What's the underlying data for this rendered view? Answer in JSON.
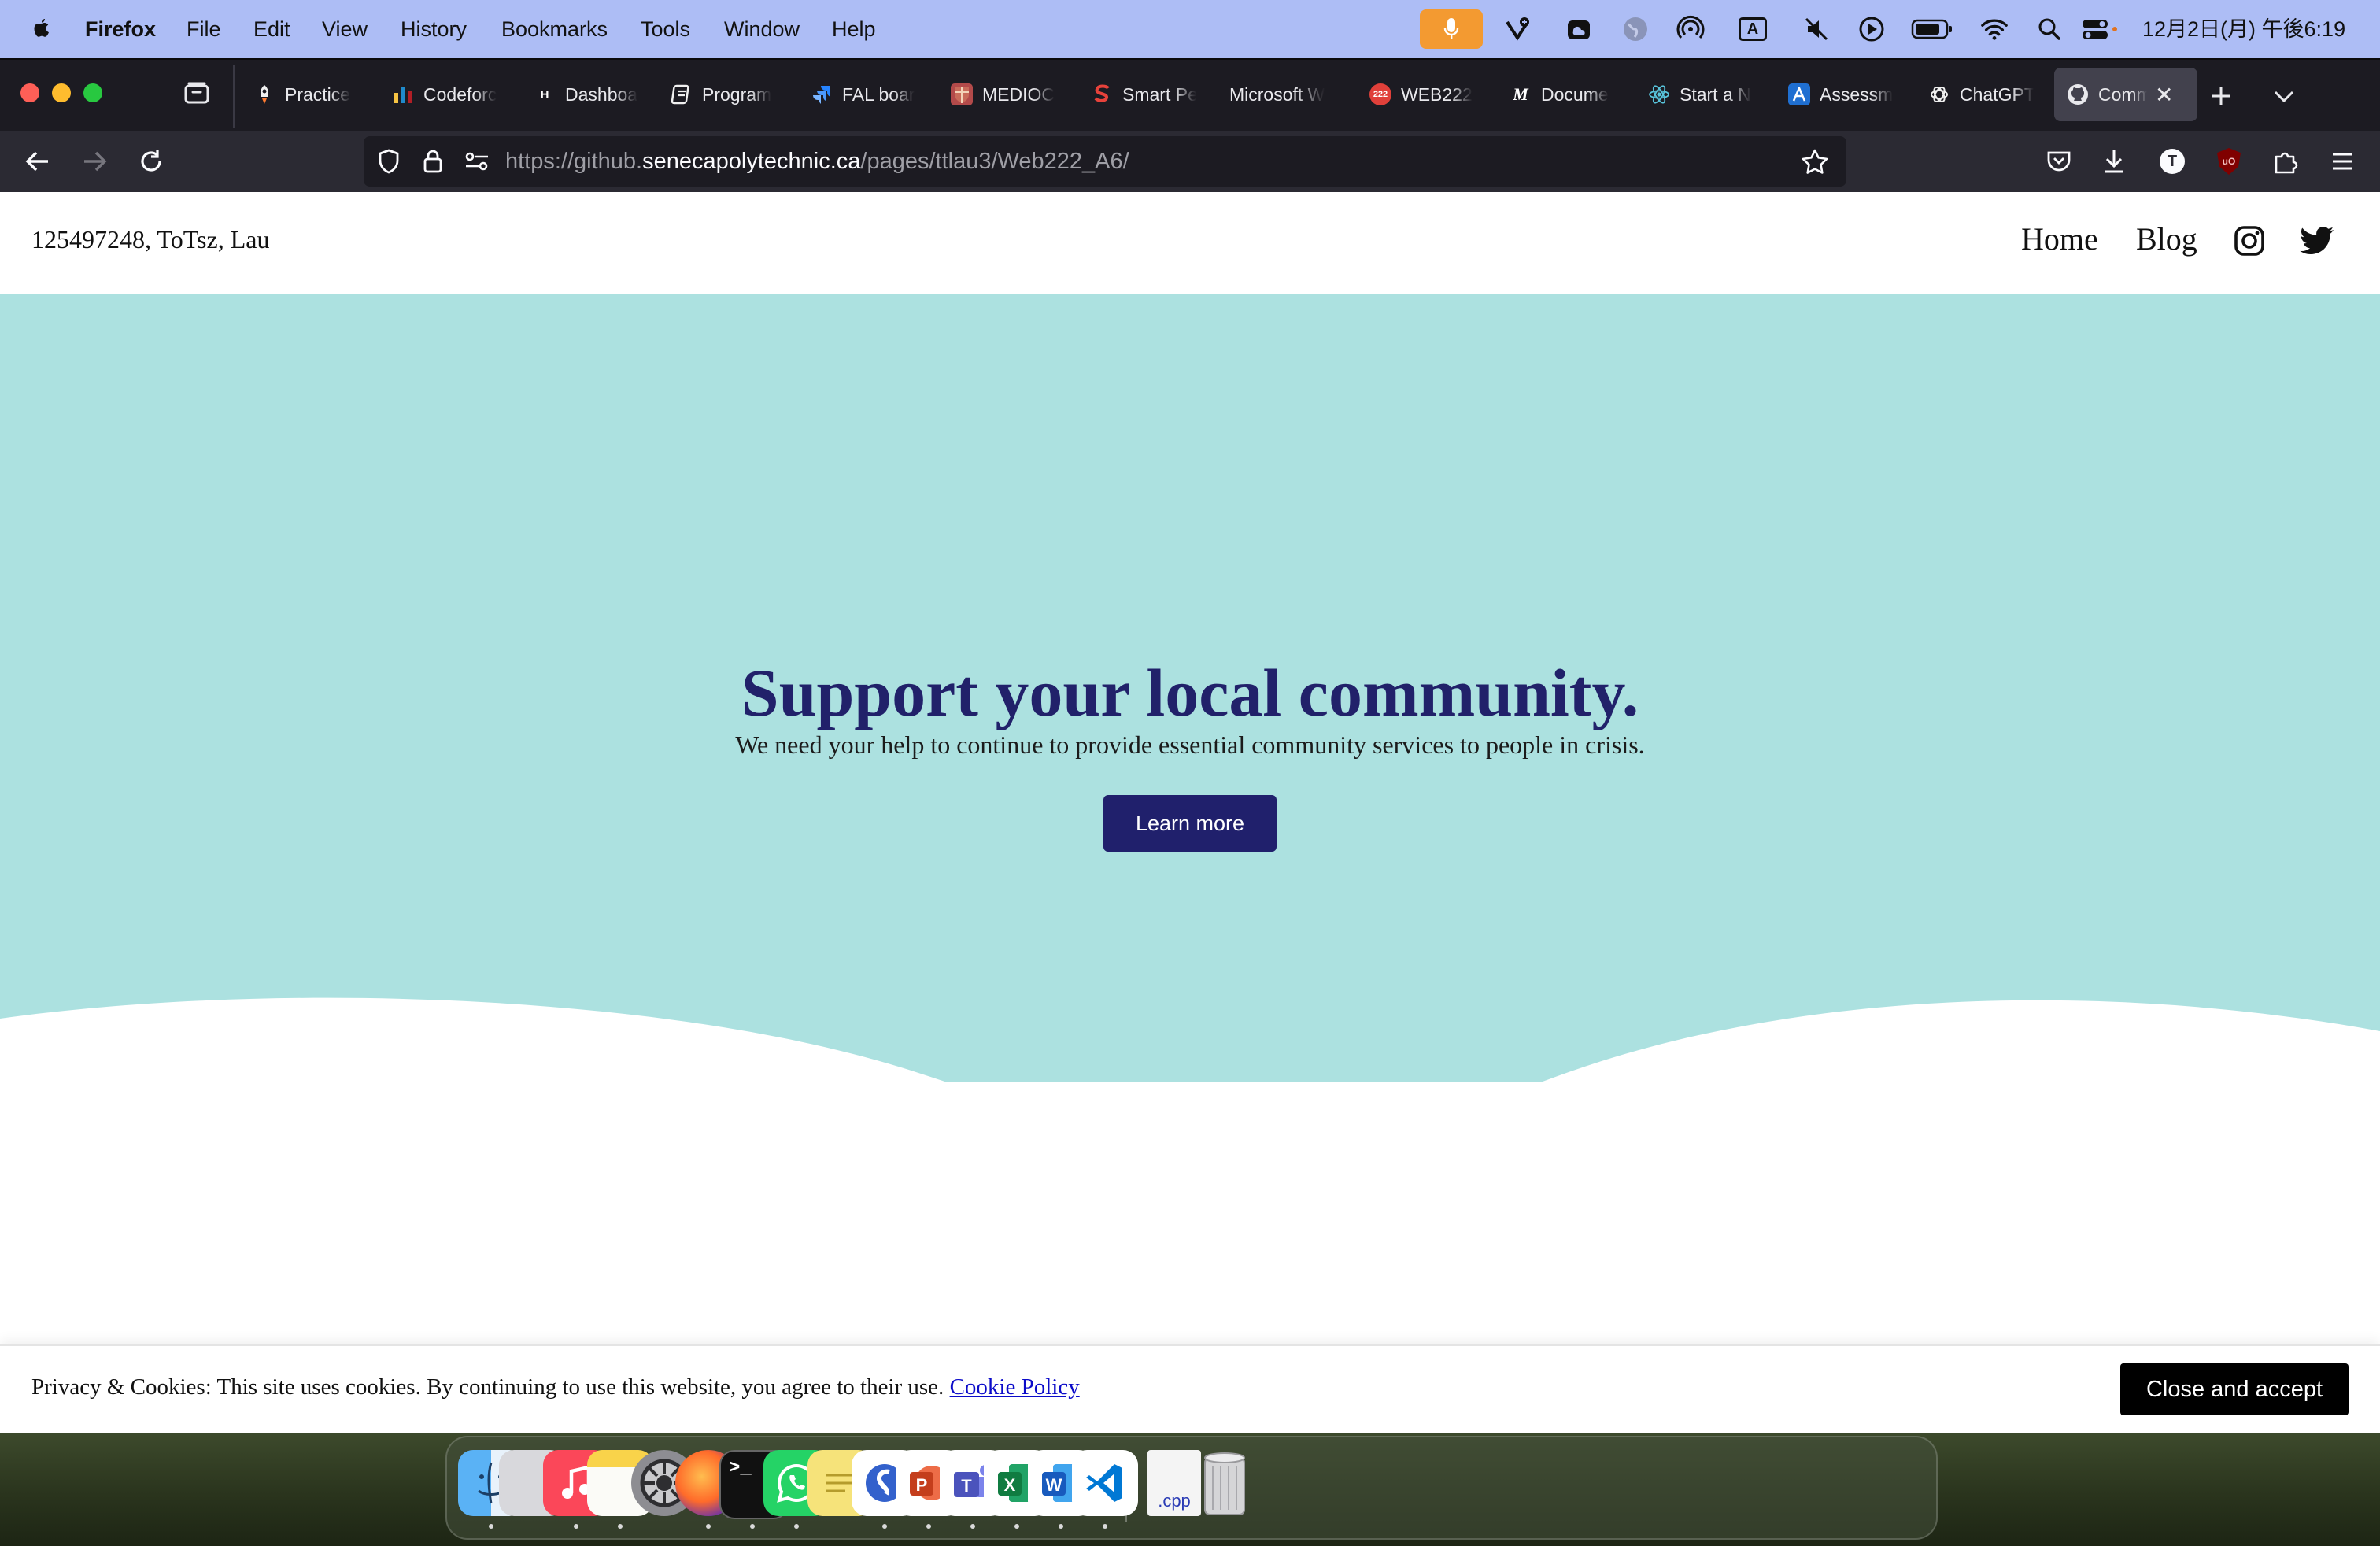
{
  "menubar": {
    "app_name": "Firefox",
    "menus": [
      "File",
      "Edit",
      "View",
      "History",
      "Bookmarks",
      "Tools",
      "Window",
      "Help"
    ],
    "clock": "12月2日(月) 午後6:19",
    "input_indicator": "A"
  },
  "browser": {
    "tabs": [
      {
        "label": "Practice"
      },
      {
        "label": "Codeforc"
      },
      {
        "label": "Dashboa"
      },
      {
        "label": "Program"
      },
      {
        "label": "FAL boar"
      },
      {
        "label": "MEDIOC"
      },
      {
        "label": "Smart Pe"
      },
      {
        "label": "Microsoft W"
      },
      {
        "label": "WEB222"
      },
      {
        "label": "Docume"
      },
      {
        "label": "Start a N"
      },
      {
        "label": "Assessm"
      },
      {
        "label": "ChatGPT"
      },
      {
        "label": "Comm",
        "active": true
      }
    ],
    "url": {
      "prefix": "https://github.",
      "domain": "senecapolytechnic.ca",
      "path": "/pages/ttlau3/Web222_A6/"
    },
    "toolbar_avatar_letter": "T",
    "ublock_label": "uO"
  },
  "site": {
    "header": {
      "id_text": "125497248, ToTsz, Lau",
      "nav": [
        "Home",
        "Blog"
      ]
    },
    "hero": {
      "title": "Support your local community.",
      "subtitle": "We need your help to continue to provide essential community services to people in crisis.",
      "button_label": "Learn more",
      "background_color": "#ace1e0"
    },
    "cookie_banner": {
      "text": "Privacy & Cookies: This site uses cookies. By continuing to use this website, you agree to their use.",
      "link_text": "Cookie Policy",
      "button_label": "Close and accept"
    }
  },
  "dock": {
    "apps": [
      "finder",
      "launchpad",
      "music",
      "notes",
      "system-settings",
      "firefox",
      "terminal",
      "whatsapp",
      "stickies",
      "simplenote",
      "powerpoint",
      "teams",
      "excel",
      "word",
      "vscode"
    ],
    "document_label": ".cpp"
  },
  "colors": {
    "menubar": "#adbdf5",
    "hero_title": "#21216a",
    "accent_button": "#20206c",
    "link": "#0b0bc9"
  }
}
